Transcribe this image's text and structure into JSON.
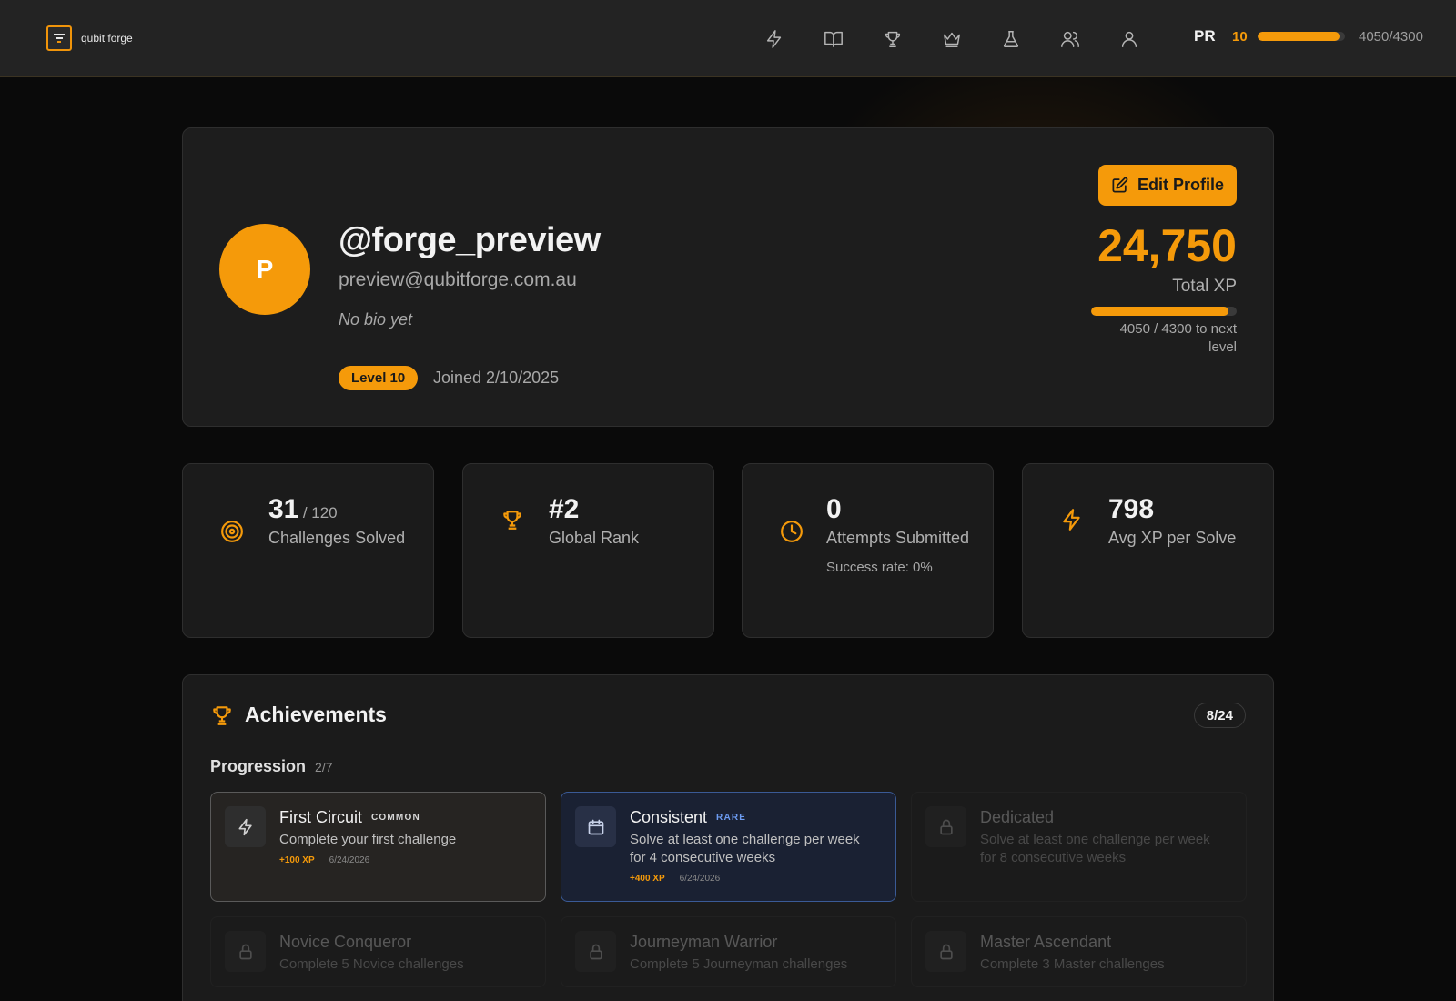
{
  "nav": {
    "brand": "qubit forge",
    "icons": [
      "lightning-icon",
      "book-icon",
      "trophy-icon",
      "crown-icon",
      "flask-icon",
      "users-icon",
      "user-icon"
    ],
    "initials": "PR",
    "level": "10",
    "xp_progress_fraction": 0.942,
    "xp_text": "4050/4300"
  },
  "profile": {
    "avatar_initial": "P",
    "username": "@forge_preview",
    "email": "preview@qubitforge.com.au",
    "bio": "No bio yet",
    "level_badge": "Level 10",
    "joined": "Joined 2/10/2025",
    "edit_label": "Edit Profile",
    "total_xp": "24,750",
    "total_xp_label": "Total XP",
    "xp_progress_fraction": 0.942,
    "xp_next": "4050 / 4300 to next level"
  },
  "stats": [
    {
      "icon": "target-icon",
      "value": "31",
      "total": "/ 120",
      "label": "Challenges Solved",
      "sub": ""
    },
    {
      "icon": "trophy-icon",
      "value": "#2",
      "total": "",
      "label": "Global Rank",
      "sub": ""
    },
    {
      "icon": "clock-icon",
      "value": "0",
      "total": "",
      "label": "Attempts Submitted",
      "sub": "Success rate: 0%"
    },
    {
      "icon": "lightning-icon",
      "value": "798",
      "total": "",
      "label": "Avg XP per Solve",
      "sub": ""
    }
  ],
  "achievements": {
    "title": "Achievements",
    "count": "8/24",
    "section": {
      "name": "Progression",
      "count": "2/7"
    },
    "items": [
      {
        "icon": "lightning-icon",
        "name": "First Circuit",
        "rarity": "COMMON",
        "desc": "Complete your first challenge",
        "xp": "+100 XP",
        "date": "6/24/2026",
        "state": "unlocked-common"
      },
      {
        "icon": "calendar-icon",
        "name": "Consistent",
        "rarity": "RARE",
        "desc": "Solve at least one challenge per week for 4 consecutive weeks",
        "xp": "+400 XP",
        "date": "6/24/2026",
        "state": "unlocked-rare"
      },
      {
        "icon": "lock-icon",
        "name": "Dedicated",
        "rarity": "",
        "desc": "Solve at least one challenge per week for 8 consecutive weeks",
        "xp": "",
        "date": "",
        "state": "locked"
      },
      {
        "icon": "lock-icon",
        "name": "Novice Conqueror",
        "rarity": "",
        "desc": "Complete 5 Novice challenges",
        "xp": "",
        "date": "",
        "state": "locked"
      },
      {
        "icon": "lock-icon",
        "name": "Journeyman Warrior",
        "rarity": "",
        "desc": "Complete 5 Journeyman challenges",
        "xp": "",
        "date": "",
        "state": "locked"
      },
      {
        "icon": "lock-icon",
        "name": "Master Ascendant",
        "rarity": "",
        "desc": "Complete 3 Master challenges",
        "xp": "",
        "date": "",
        "state": "locked"
      }
    ]
  },
  "colors": {
    "accent": "#f59a0a",
    "background": "#0a0a0a",
    "card": "#1b1b1b",
    "rare": "#6d9cf2"
  }
}
